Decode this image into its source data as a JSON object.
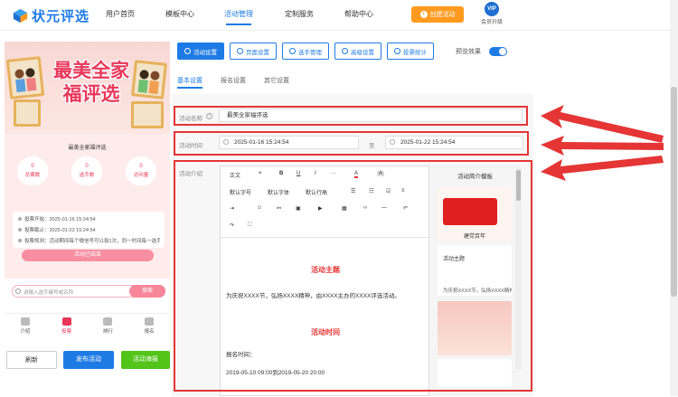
{
  "brand": {
    "name": "状元评选"
  },
  "nav": {
    "items": [
      "用户首页",
      "模板中心",
      "活动管理",
      "定制服务",
      "帮助中心"
    ],
    "active": 2
  },
  "header": {
    "create_label": "创建活动",
    "vip_badge": "VIP",
    "vip_label": "会员升级"
  },
  "preview": {
    "poster_title": "最美全家福评选",
    "activity_name": "最美全家福评选",
    "stats": [
      {
        "value": "0",
        "label": "总票数"
      },
      {
        "value": "0",
        "label": "选手数"
      },
      {
        "value": "0",
        "label": "访问量"
      }
    ],
    "info": [
      "投票开始：2025-01-16 15:24:54",
      "投票截止：2025-01-22 15:24:54",
      "投票规则：活动期间每个微信号可以投1次，同一时间每一选手投1票"
    ],
    "vote_button": "活动已结束",
    "search_placeholder": "请输入选手编号或名称",
    "search_button": "搜索",
    "tabs": [
      {
        "label": "介绍",
        "icon": "intro-icon"
      },
      {
        "label": "投票",
        "icon": "vote-icon"
      },
      {
        "label": "排行",
        "icon": "rank-icon"
      },
      {
        "label": "报名",
        "icon": "signup-icon"
      }
    ],
    "buttons": {
      "refresh": "刷新",
      "publish": "发布活动",
      "poster": "活动海报"
    }
  },
  "toolbar": {
    "buttons": [
      "活动设置",
      "页面设置",
      "选手管理",
      "高级设置",
      "投票统计"
    ],
    "preview_label": "预览效果"
  },
  "subtabs": [
    "基本设置",
    "报名设置",
    "其它设置"
  ],
  "form": {
    "name_label": "活动名称",
    "name_value": "最美全家福评选",
    "time_label": "活动时间",
    "start_time": "2025-01-16 15:24:54",
    "range_sep": "至",
    "end_time": "2025-01-22 15:24:54",
    "intro_label": "活动介绍"
  },
  "editor": {
    "toolbar_row1": [
      "正文",
      "❝",
      "B",
      "U",
      "I",
      "···",
      "A",
      "A"
    ],
    "toolbar_row2": [
      "默认字号",
      "默认字体",
      "默认行高"
    ],
    "content": {
      "heading1": "活动主题",
      "para1": "为庆祝XXXX节，弘扬XXXX精神，由XXXX主办的XXXX评选活动。",
      "heading2": "活动时间",
      "line1": "报名时间：",
      "line2": "2019-05-10 09:00到2019-05-20 20:00"
    }
  },
  "templates": {
    "title": "活动简介模板",
    "items": [
      "建党百年",
      "活动主题",
      "为庆祝XXXX节，弘扬XXXX精神"
    ]
  },
  "colors": {
    "primary": "#1e7be6",
    "orange": "#ff9a1f",
    "pink": "#e8375a",
    "red_annotation": "#e53535",
    "green": "#52c41a"
  }
}
